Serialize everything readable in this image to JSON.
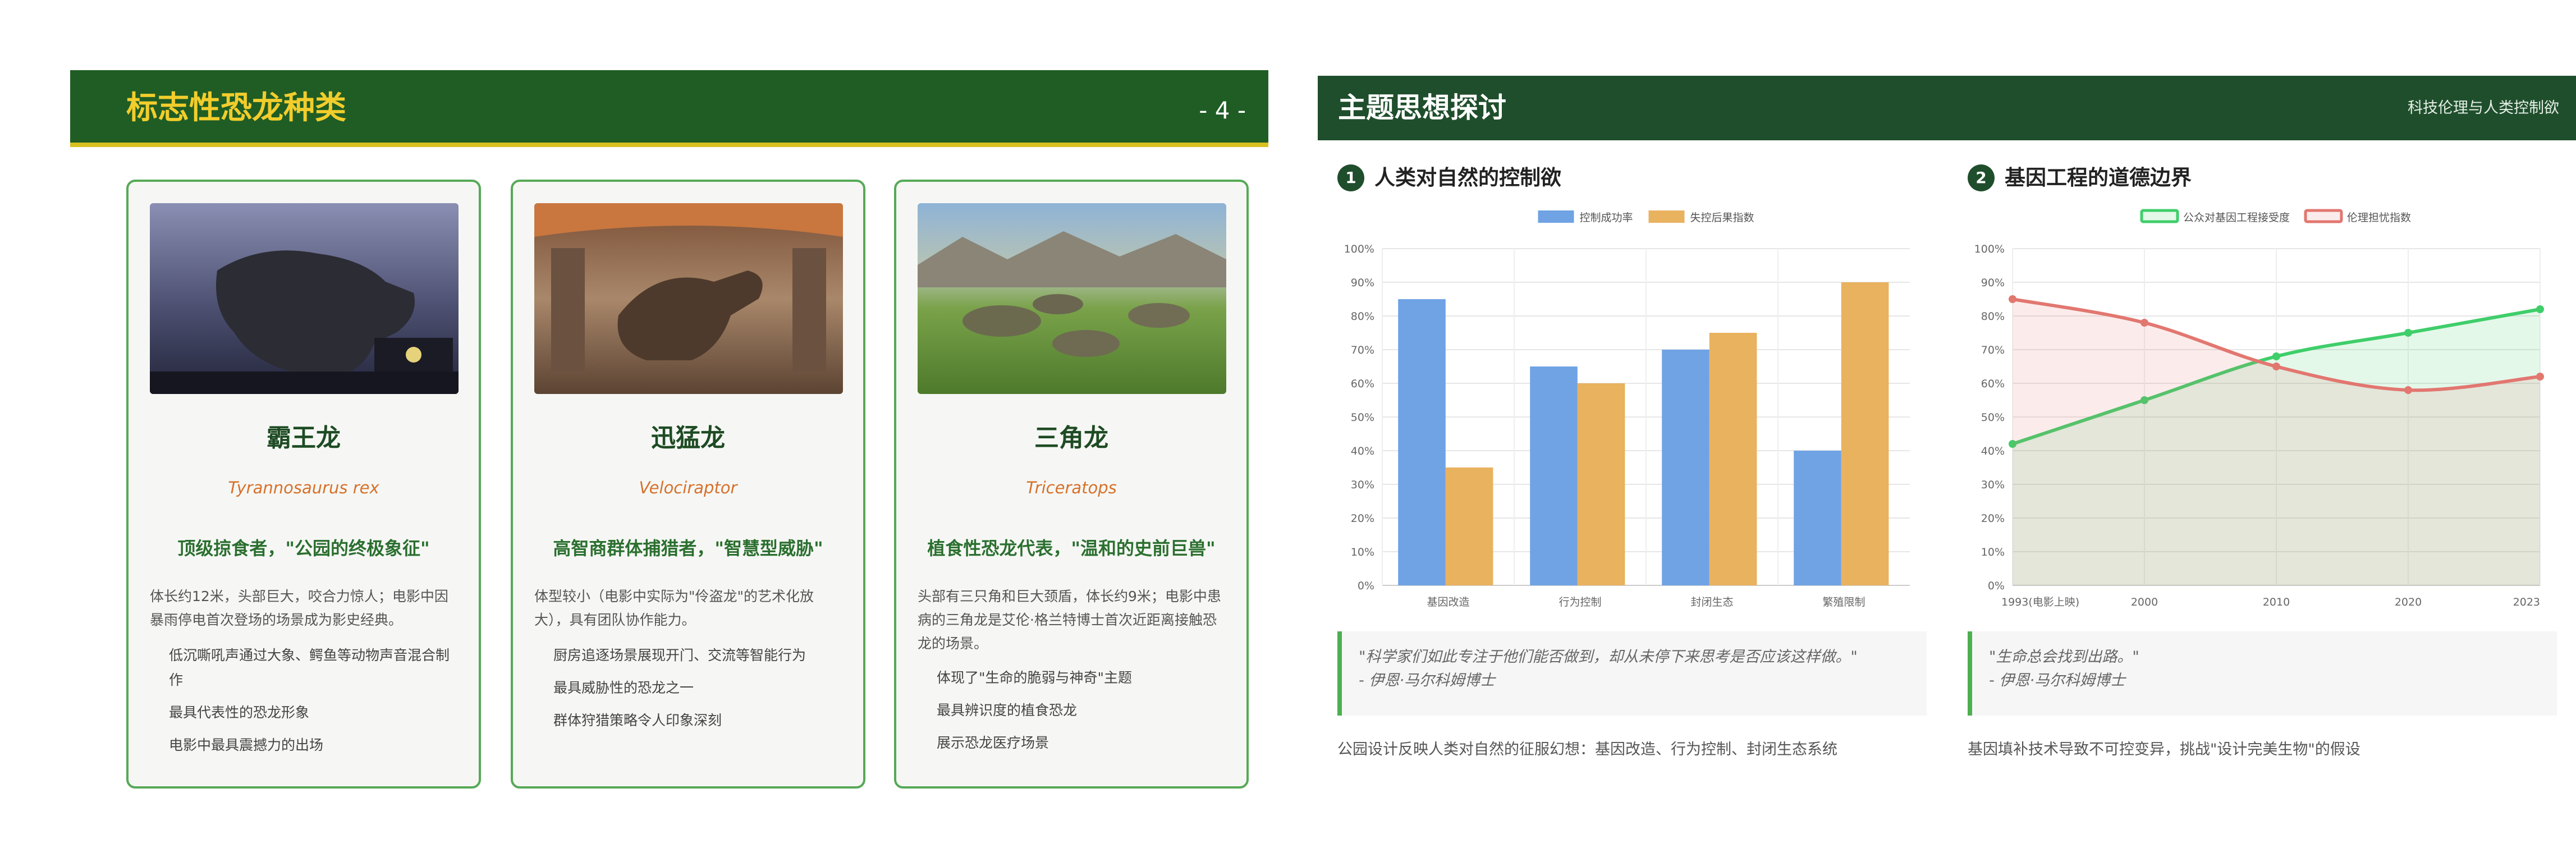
{
  "slide_left": {
    "title": "标志性恐龙种类",
    "page": "- 4 -",
    "cards": [
      {
        "name": "霸王龙",
        "latin": "Tyrannosaurus rex",
        "tagline": "顶级掠食者，\"公园的终极象征\"",
        "desc": "体长约12米，头部巨大，咬合力惊人；电影中因暴雨停电首次登场的场景成为影史经典。",
        "bullets": [
          "低沉嘶吼声通过大象、鳄鱼等动物声音混合制作",
          "最具代表性的恐龙形象",
          "电影中最具震撼力的出场"
        ]
      },
      {
        "name": "迅猛龙",
        "latin": "Velociraptor",
        "tagline": "高智商群体捕猎者，\"智慧型威胁\"",
        "desc": "体型较小（电影中实际为\"伶盗龙\"的艺术化放大），具有团队协作能力。",
        "bullets": [
          "厨房追逐场景展现开门、交流等智能行为",
          "最具威胁性的恐龙之一",
          "群体狩猎策略令人印象深刻"
        ]
      },
      {
        "name": "三角龙",
        "latin": "Triceratops",
        "tagline": "植食性恐龙代表，\"温和的史前巨兽\"",
        "desc": "头部有三只角和巨大颈盾，体长约9米；电影中患病的三角龙是艾伦·格兰特博士首次近距离接触恐龙的场景。",
        "bullets": [
          "体现了\"生命的脆弱与神奇\"主题",
          "最具辨识度的植食恐龙",
          "展示恐龙医疗场景"
        ]
      }
    ]
  },
  "slide_right": {
    "title": "主题思想探讨",
    "subtitle": "科技伦理与人类控制欲",
    "panels": [
      {
        "num": "1",
        "title": "人类对自然的控制欲",
        "quote": "\"科学家们如此专注于他们能否做到，却从未停下来思考是否应该这样做。\"",
        "author": "- 伊恩·马尔科姆博士",
        "note": "公园设计反映人类对自然的征服幻想：基因改造、行为控制、封闭生态系统"
      },
      {
        "num": "2",
        "title": "基因工程的道德边界",
        "quote": "\"生命总会找到出路。\"",
        "author": "- 伊恩·马尔科姆博士",
        "note": "基因填补技术导致不可控变异，挑战\"设计完美生物\"的假设"
      }
    ]
  },
  "colors": {
    "left_header": "#1f5d24",
    "left_title": "#f2cd2c",
    "card_border": "#57a957",
    "right_header": "#1f4e2c",
    "bar_blue": "#6fa3e4",
    "bar_orange": "#e9b25f",
    "line_green": "#3fce6a",
    "line_red": "#e27770"
  },
  "chart_data": [
    {
      "type": "bar",
      "categories": [
        "基因改造",
        "行为控制",
        "封闭生态",
        "繁殖限制"
      ],
      "series": [
        {
          "name": "控制成功率",
          "values": [
            85,
            65,
            70,
            40
          ]
        },
        {
          "name": "失控后果指数",
          "values": [
            35,
            60,
            75,
            90
          ]
        }
      ],
      "yticks": [
        "0%",
        "10%",
        "20%",
        "30%",
        "40%",
        "50%",
        "60%",
        "70%",
        "80%",
        "90%",
        "100%"
      ],
      "ylim": [
        0,
        100
      ],
      "grid": true,
      "legend": "top"
    },
    {
      "type": "area",
      "categories": [
        "1993(电影上映)",
        "2000",
        "2010",
        "2020",
        "2023"
      ],
      "series": [
        {
          "name": "公众对基因工程接受度",
          "values": [
            42,
            55,
            68,
            75,
            82
          ]
        },
        {
          "name": "伦理担忧指数",
          "values": [
            85,
            78,
            65,
            58,
            62
          ]
        }
      ],
      "yticks": [
        "0%",
        "10%",
        "20%",
        "30%",
        "40%",
        "50%",
        "60%",
        "70%",
        "80%",
        "90%",
        "100%"
      ],
      "ylim": [
        0,
        100
      ],
      "grid": true,
      "legend": "top"
    }
  ]
}
